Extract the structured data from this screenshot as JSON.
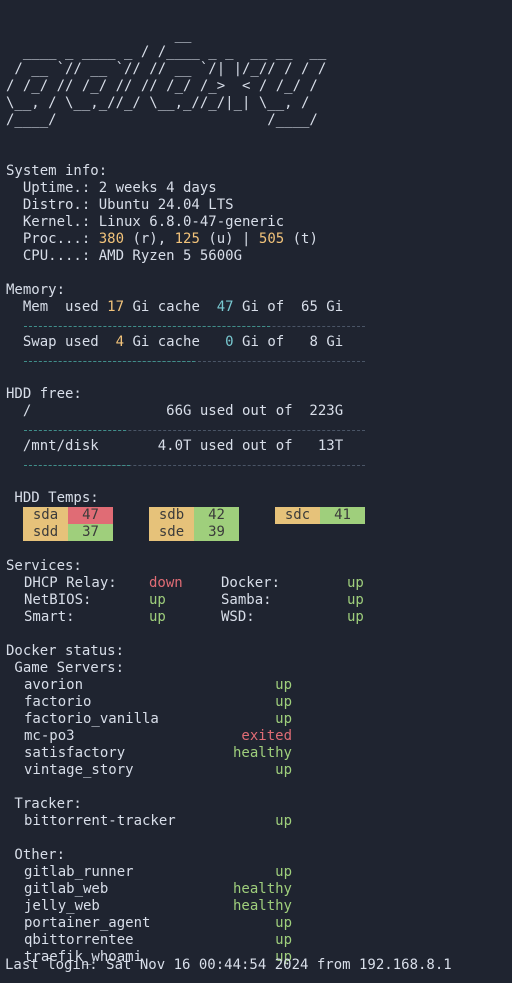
{
  "ascii_art": [
    "                    __",
    "  ____ _ ____ _ / /____ _ _  __ __  __",
    " / __ `// __ `// // __ `/| |/_// / / /",
    "/ /_/ // /_/ // // /_/ /_>  < / /_/ /",
    "\\__, / \\__,_//_/ \\__,_//_/|_| \\__, /",
    "/____/                         /____/"
  ],
  "system_info": {
    "heading": "System info:",
    "uptime_label": "  Uptime.: ",
    "uptime": "2 weeks 4 days",
    "distro_label": "  Distro.: ",
    "distro": "Ubuntu 24.04 LTS",
    "kernel_label": "  Kernel.: ",
    "kernel": "Linux 6.8.0-47-generic",
    "proc_label": "  Proc...: ",
    "proc_running": "380",
    "proc_r": " (r), ",
    "proc_user": "125",
    "proc_u": " (u) | ",
    "proc_total": "505",
    "proc_t": " (t)",
    "cpu_label": "  CPU....: ",
    "cpu": "AMD Ryzen 5 5600G"
  },
  "memory": {
    "heading": "Memory:",
    "mem_label": "  Mem  used ",
    "mem_used": "17",
    "mem_mid": " Gi cache  ",
    "mem_cache": "47",
    "mem_tail": " Gi of  65 Gi",
    "mem_used_fraction": 0.26,
    "mem_cache_fraction": 0.72,
    "swap_label": "  Swap used  ",
    "swap_used": "4",
    "swap_mid": " Gi cache   ",
    "swap_cache": "0",
    "swap_tail": " Gi of   8 Gi",
    "swap_used_fraction": 0.5
  },
  "hdd_free": {
    "heading": "HDD free:",
    "root_line": "  /                66G used out of  223G",
    "root_fraction": 0.3,
    "disk_line": "  /mnt/disk       4.0T used out of   13T",
    "disk_fraction": 0.31
  },
  "hdd_temps": {
    "heading": " HDD Temps:",
    "disks": [
      {
        "name": "sda",
        "temp": "47",
        "hot": true
      },
      {
        "name": "sdb",
        "temp": "42",
        "hot": false
      },
      {
        "name": "sdc",
        "temp": "41",
        "hot": false
      },
      {
        "name": "sdd",
        "temp": "37",
        "hot": false
      },
      {
        "name": "sde",
        "temp": "39",
        "hot": false
      }
    ]
  },
  "services": {
    "heading": "Services:",
    "dhcp_label": "DHCP Relay:",
    "dhcp_status": "down",
    "docker_label": "Docker:",
    "docker_status": "up",
    "netbios_label": "NetBIOS:",
    "netbios_status": "up",
    "samba_label": "Samba:",
    "samba_status": "up",
    "smart_label": "Smart:",
    "smart_status": "up",
    "wsd_label": "WSD:",
    "wsd_status": "up"
  },
  "docker_status": {
    "heading": "Docker status:",
    "game_heading": " Game Servers:",
    "game": [
      {
        "name": "avorion",
        "status": "up"
      },
      {
        "name": "factorio",
        "status": "up"
      },
      {
        "name": "factorio_vanilla",
        "status": "up"
      },
      {
        "name": "mc-po3",
        "status": "exited"
      },
      {
        "name": "satisfactory",
        "status": "healthy"
      },
      {
        "name": "vintage_story",
        "status": "up"
      }
    ],
    "tracker_heading": " Tracker:",
    "tracker": [
      {
        "name": "bittorrent-tracker",
        "status": "up"
      }
    ],
    "other_heading": " Other:",
    "other": [
      {
        "name": "gitlab_runner",
        "status": "up"
      },
      {
        "name": "gitlab_web",
        "status": "healthy"
      },
      {
        "name": "jelly_web",
        "status": "healthy"
      },
      {
        "name": "portainer_agent",
        "status": "up"
      },
      {
        "name": "qbittorrentee",
        "status": "up"
      },
      {
        "name": "traefik_whoami",
        "status": "up"
      }
    ]
  },
  "last_login": "Last login: Sat Nov 16 00:44:54 2024 from 192.168.8.1",
  "colors": {
    "background": "#1f2430",
    "text": "#d8dee9",
    "accent_orange": "#f2c37a",
    "accent_cyan": "#78c8d0",
    "status_up": "#9fcf7c",
    "status_down": "#e06c75"
  }
}
